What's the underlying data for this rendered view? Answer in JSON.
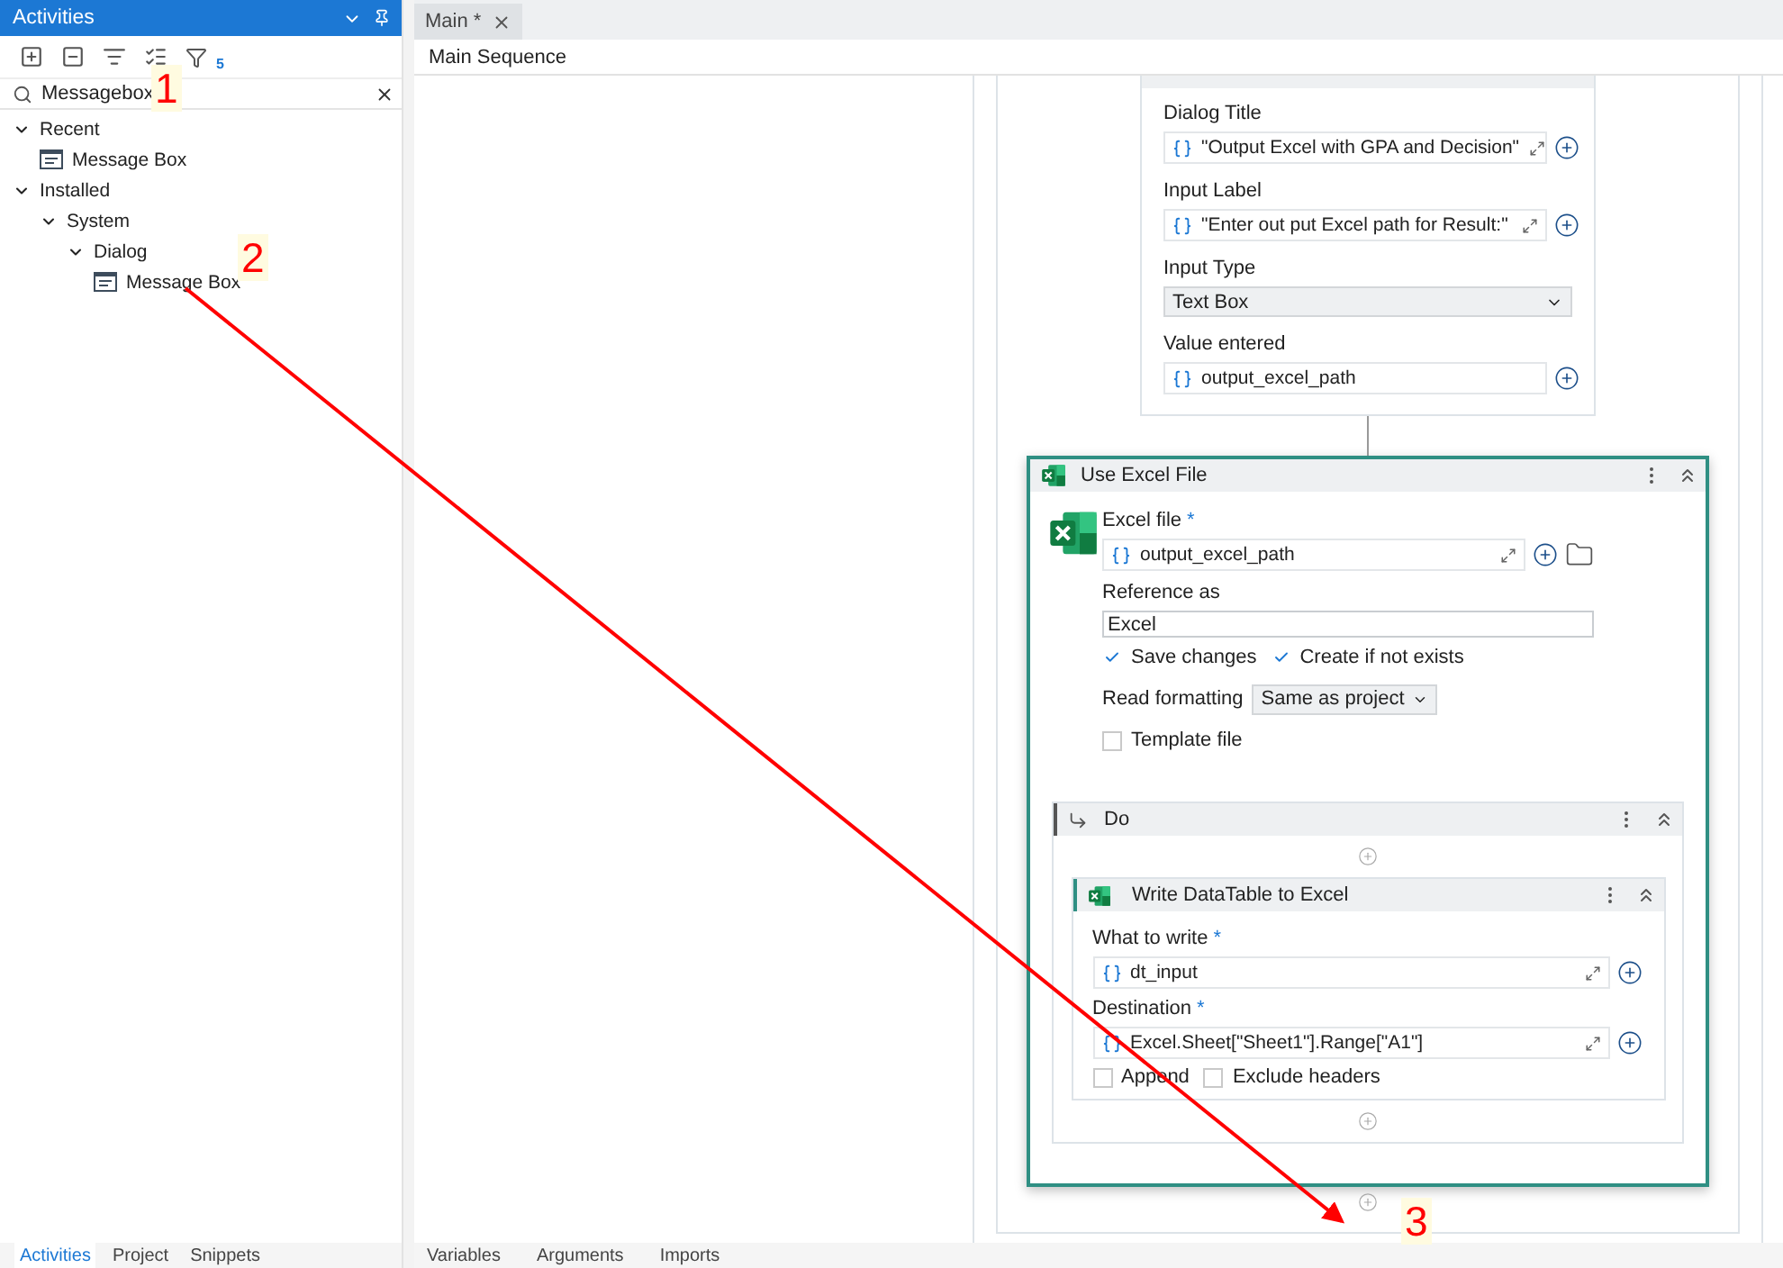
{
  "activities_panel": {
    "title": "Activities",
    "filter_count": "5",
    "search": {
      "value": "Messagebox"
    },
    "tree": [
      {
        "label": "Recent",
        "expanded": true,
        "children": [
          {
            "label": "Message Box",
            "kind": "activity"
          }
        ]
      },
      {
        "label": "Installed",
        "expanded": true,
        "children": [
          {
            "label": "System",
            "expanded": true,
            "children": [
              {
                "label": "Dialog",
                "expanded": true,
                "children": [
                  {
                    "label": "Message Box",
                    "kind": "activity"
                  }
                ]
              }
            ]
          }
        ]
      }
    ],
    "bottom_tabs": [
      {
        "label": "Activities",
        "selected": true
      },
      {
        "label": "Project",
        "selected": false
      },
      {
        "label": "Snippets",
        "selected": false
      }
    ]
  },
  "document_tabs": [
    {
      "label": "Main *",
      "selected": true
    }
  ],
  "breadcrumb": "Main Sequence",
  "input_dialog": {
    "fields": [
      {
        "label": "Dialog Title",
        "kind": "expression",
        "value": "\"Output Excel with GPA and Decision\""
      },
      {
        "label": "Input Label",
        "kind": "expression",
        "value": "\"Enter out put Excel path for Result:\""
      },
      {
        "label": "Input Type",
        "kind": "select",
        "value": "Text Box"
      },
      {
        "label": "Value entered",
        "kind": "variable",
        "value": "output_excel_path"
      }
    ]
  },
  "use_excel_file": {
    "title": "Use Excel File",
    "excel_file": {
      "label": "Excel file",
      "required_mark": "*",
      "value": "output_excel_path"
    },
    "reference_as": {
      "label": "Reference as",
      "value": "Excel"
    },
    "options": [
      {
        "label": "Save changes",
        "checked": true
      },
      {
        "label": "Create if not exists",
        "checked": true
      }
    ],
    "read_formatting": {
      "label": "Read formatting",
      "value": "Same as project"
    },
    "template_file": {
      "label": "Template file",
      "checked": false
    },
    "do": {
      "title": "Do",
      "activity": {
        "title": "Write DataTable to Excel",
        "fields": [
          {
            "label": "What to write",
            "required_mark": "*",
            "value": "dt_input"
          },
          {
            "label": "Destination",
            "required_mark": "*",
            "value": "Excel.Sheet[\"Sheet1\"].Range[\"A1\"]"
          }
        ],
        "options": [
          {
            "label": "Append",
            "checked": false
          },
          {
            "label": "Exclude headers",
            "checked": false
          }
        ]
      }
    }
  },
  "designer_tabs": [
    {
      "label": "Variables"
    },
    {
      "label": "Arguments"
    },
    {
      "label": "Imports"
    }
  ],
  "annotations": [
    {
      "label": "1"
    },
    {
      "label": "2"
    },
    {
      "label": "3"
    }
  ]
}
